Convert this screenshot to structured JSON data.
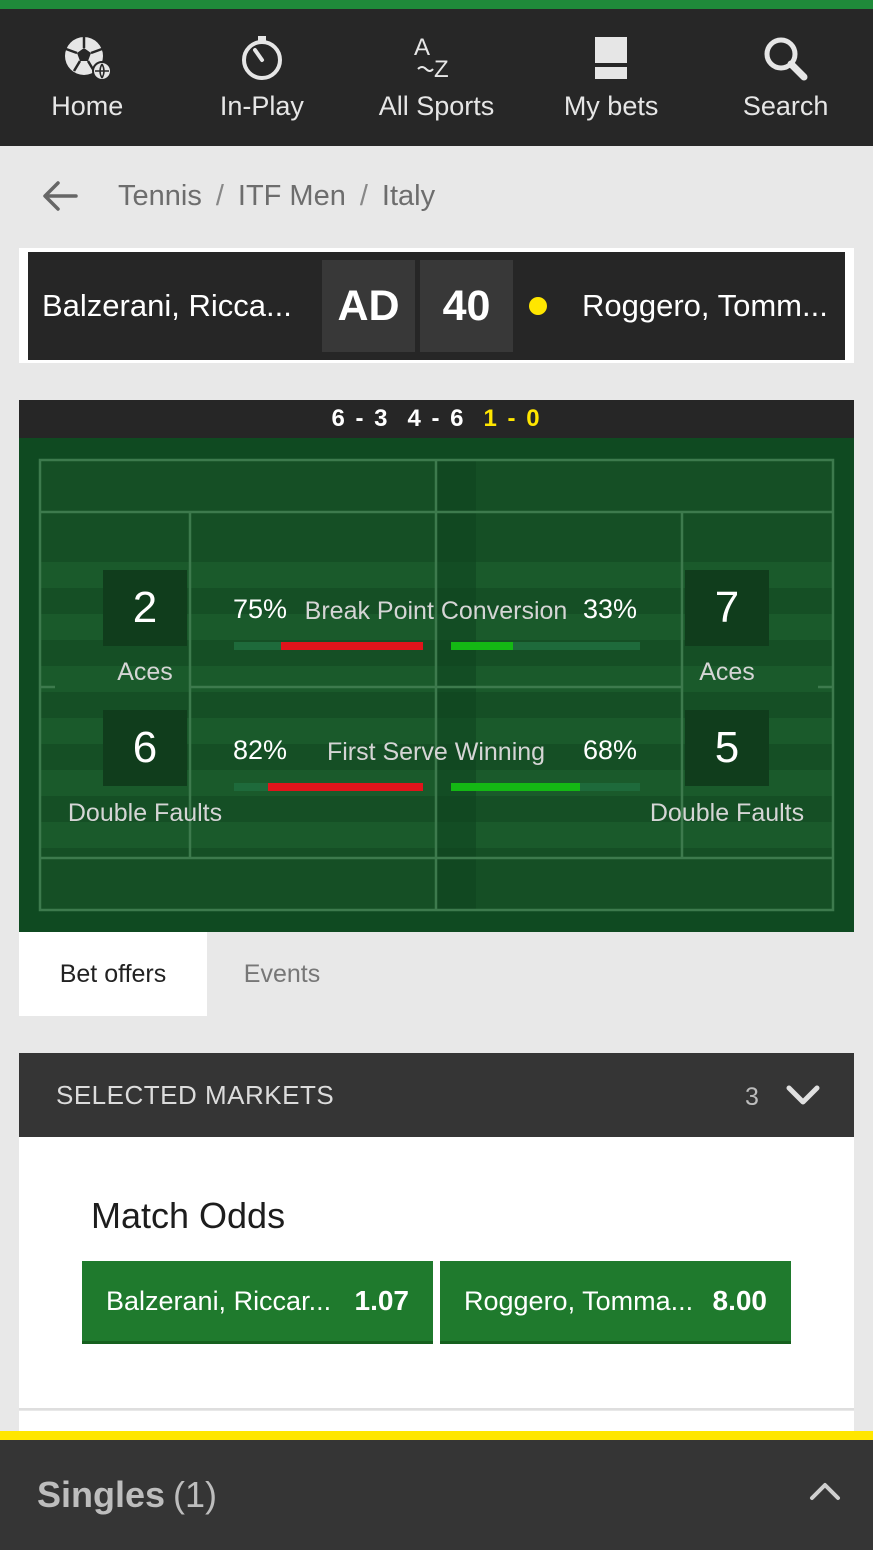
{
  "nav": {
    "items": [
      {
        "label": "Home",
        "icon": "soccer-ball-icon"
      },
      {
        "label": "In-Play",
        "icon": "stopwatch-icon"
      },
      {
        "label": "All Sports",
        "icon": "a-z-icon"
      },
      {
        "label": "My bets",
        "icon": "bet-slip-icon"
      },
      {
        "label": "Search",
        "icon": "search-icon"
      }
    ]
  },
  "breadcrumb": {
    "items": [
      "Tennis",
      "ITF Men",
      "Italy"
    ],
    "separator": "/"
  },
  "scoreboard": {
    "player_left": "Balzerani, Ricca...",
    "player_right": "Roggero, Tomm...",
    "points_left": "AD",
    "points_right": "40",
    "serving": "right"
  },
  "sets": {
    "set1": "6 - 3",
    "set2": "4 - 6",
    "set3": "1 - 0"
  },
  "stats": {
    "left_aces": "2",
    "left_aces_label": "Aces",
    "left_double_faults": "6",
    "left_double_faults_label": "Double Faults",
    "right_aces": "7",
    "right_aces_label": "Aces",
    "right_double_faults": "5",
    "right_double_faults_label": "Double Faults",
    "break_point": {
      "title": "Break Point Conversion",
      "left_pct": "75%",
      "right_pct": "33%",
      "left_value": 0.75,
      "right_value": 0.33
    },
    "first_serve": {
      "title": "First Serve Winning",
      "left_pct": "82%",
      "right_pct": "68%",
      "left_value": 0.82,
      "right_value": 0.68
    }
  },
  "tabs": [
    {
      "label": "Bet offers",
      "active": true
    },
    {
      "label": "Events",
      "active": false
    }
  ],
  "markets": {
    "header": "SELECTED MARKETS",
    "count": "3"
  },
  "match_odds": {
    "title": "Match Odds",
    "selections": [
      {
        "name": "Balzerani, Riccar...",
        "price": "1.07"
      },
      {
        "name": "Roggero, Tomma...",
        "price": "8.00"
      }
    ]
  },
  "betslip": {
    "title": "Singles",
    "count": "(1)"
  },
  "colors": {
    "brand_green": "#1f7a2d",
    "accent_yellow": "#ffe600",
    "bar_red": "#e0141b",
    "bar_green": "#14b814"
  }
}
